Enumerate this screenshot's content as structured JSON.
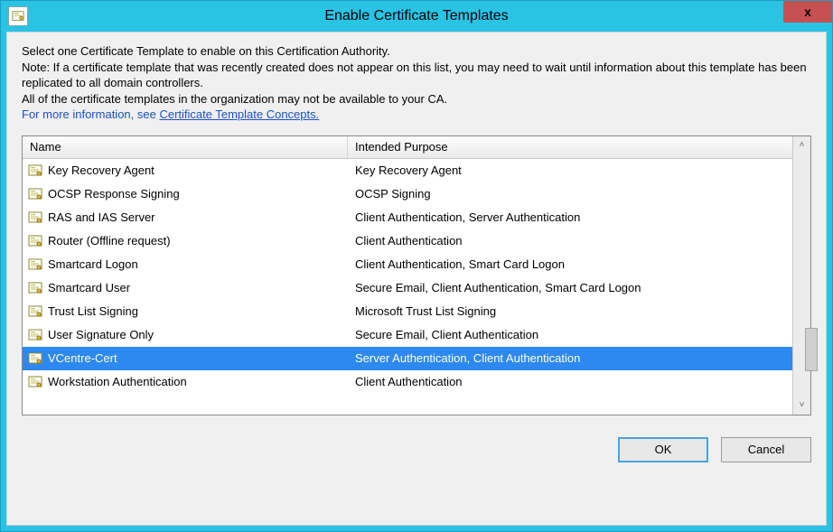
{
  "window": {
    "title": "Enable Certificate Templates",
    "close_label": "x"
  },
  "instructions": {
    "line1": "Select one Certificate Template to enable on this Certification Authority.",
    "line2": "Note: If a certificate template that was recently created does not appear on this list, you may need to wait until information about this template has been replicated to all domain controllers.",
    "line3": "All of the certificate templates in the organization may not be available to your CA.",
    "more_prefix": "For more information, see ",
    "more_link": "Certificate Template Concepts."
  },
  "columns": {
    "name": "Name",
    "purpose": "Intended Purpose"
  },
  "rows": [
    {
      "name": "Key Recovery Agent",
      "purpose": "Key Recovery Agent",
      "selected": false
    },
    {
      "name": "OCSP Response Signing",
      "purpose": "OCSP Signing",
      "selected": false
    },
    {
      "name": "RAS and IAS Server",
      "purpose": "Client Authentication, Server Authentication",
      "selected": false
    },
    {
      "name": "Router (Offline request)",
      "purpose": "Client Authentication",
      "selected": false
    },
    {
      "name": "Smartcard Logon",
      "purpose": "Client Authentication, Smart Card Logon",
      "selected": false
    },
    {
      "name": "Smartcard User",
      "purpose": "Secure Email, Client Authentication, Smart Card Logon",
      "selected": false
    },
    {
      "name": "Trust List Signing",
      "purpose": "Microsoft Trust List Signing",
      "selected": false
    },
    {
      "name": "User Signature Only",
      "purpose": "Secure Email, Client Authentication",
      "selected": false
    },
    {
      "name": "VCentre-Cert",
      "purpose": "Server Authentication, Client Authentication",
      "selected": true
    },
    {
      "name": "Workstation Authentication",
      "purpose": "Client Authentication",
      "selected": false
    }
  ],
  "buttons": {
    "ok": "OK",
    "cancel": "Cancel"
  },
  "scroll": {
    "up": "˄",
    "down": "˅"
  }
}
